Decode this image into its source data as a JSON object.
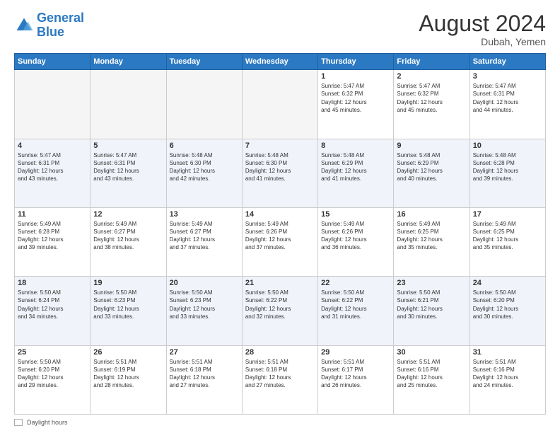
{
  "header": {
    "logo_general": "General",
    "logo_blue": "Blue",
    "month_year": "August 2024",
    "location": "Dubah, Yemen"
  },
  "days_of_week": [
    "Sunday",
    "Monday",
    "Tuesday",
    "Wednesday",
    "Thursday",
    "Friday",
    "Saturday"
  ],
  "footer": {
    "label": "Daylight hours"
  },
  "weeks": [
    {
      "days": [
        {
          "num": "",
          "info": "",
          "empty": true
        },
        {
          "num": "",
          "info": "",
          "empty": true
        },
        {
          "num": "",
          "info": "",
          "empty": true
        },
        {
          "num": "",
          "info": "",
          "empty": true
        },
        {
          "num": "1",
          "info": "Sunrise: 5:47 AM\nSunset: 6:32 PM\nDaylight: 12 hours\nand 45 minutes."
        },
        {
          "num": "2",
          "info": "Sunrise: 5:47 AM\nSunset: 6:32 PM\nDaylight: 12 hours\nand 45 minutes."
        },
        {
          "num": "3",
          "info": "Sunrise: 5:47 AM\nSunset: 6:31 PM\nDaylight: 12 hours\nand 44 minutes."
        }
      ]
    },
    {
      "alt": true,
      "days": [
        {
          "num": "4",
          "info": "Sunrise: 5:47 AM\nSunset: 6:31 PM\nDaylight: 12 hours\nand 43 minutes."
        },
        {
          "num": "5",
          "info": "Sunrise: 5:47 AM\nSunset: 6:31 PM\nDaylight: 12 hours\nand 43 minutes."
        },
        {
          "num": "6",
          "info": "Sunrise: 5:48 AM\nSunset: 6:30 PM\nDaylight: 12 hours\nand 42 minutes."
        },
        {
          "num": "7",
          "info": "Sunrise: 5:48 AM\nSunset: 6:30 PM\nDaylight: 12 hours\nand 41 minutes."
        },
        {
          "num": "8",
          "info": "Sunrise: 5:48 AM\nSunset: 6:29 PM\nDaylight: 12 hours\nand 41 minutes."
        },
        {
          "num": "9",
          "info": "Sunrise: 5:48 AM\nSunset: 6:29 PM\nDaylight: 12 hours\nand 40 minutes."
        },
        {
          "num": "10",
          "info": "Sunrise: 5:48 AM\nSunset: 6:28 PM\nDaylight: 12 hours\nand 39 minutes."
        }
      ]
    },
    {
      "days": [
        {
          "num": "11",
          "info": "Sunrise: 5:49 AM\nSunset: 6:28 PM\nDaylight: 12 hours\nand 39 minutes."
        },
        {
          "num": "12",
          "info": "Sunrise: 5:49 AM\nSunset: 6:27 PM\nDaylight: 12 hours\nand 38 minutes."
        },
        {
          "num": "13",
          "info": "Sunrise: 5:49 AM\nSunset: 6:27 PM\nDaylight: 12 hours\nand 37 minutes."
        },
        {
          "num": "14",
          "info": "Sunrise: 5:49 AM\nSunset: 6:26 PM\nDaylight: 12 hours\nand 37 minutes."
        },
        {
          "num": "15",
          "info": "Sunrise: 5:49 AM\nSunset: 6:26 PM\nDaylight: 12 hours\nand 36 minutes."
        },
        {
          "num": "16",
          "info": "Sunrise: 5:49 AM\nSunset: 6:25 PM\nDaylight: 12 hours\nand 35 minutes."
        },
        {
          "num": "17",
          "info": "Sunrise: 5:49 AM\nSunset: 6:25 PM\nDaylight: 12 hours\nand 35 minutes."
        }
      ]
    },
    {
      "alt": true,
      "days": [
        {
          "num": "18",
          "info": "Sunrise: 5:50 AM\nSunset: 6:24 PM\nDaylight: 12 hours\nand 34 minutes."
        },
        {
          "num": "19",
          "info": "Sunrise: 5:50 AM\nSunset: 6:23 PM\nDaylight: 12 hours\nand 33 minutes."
        },
        {
          "num": "20",
          "info": "Sunrise: 5:50 AM\nSunset: 6:23 PM\nDaylight: 12 hours\nand 33 minutes."
        },
        {
          "num": "21",
          "info": "Sunrise: 5:50 AM\nSunset: 6:22 PM\nDaylight: 12 hours\nand 32 minutes."
        },
        {
          "num": "22",
          "info": "Sunrise: 5:50 AM\nSunset: 6:22 PM\nDaylight: 12 hours\nand 31 minutes."
        },
        {
          "num": "23",
          "info": "Sunrise: 5:50 AM\nSunset: 6:21 PM\nDaylight: 12 hours\nand 30 minutes."
        },
        {
          "num": "24",
          "info": "Sunrise: 5:50 AM\nSunset: 6:20 PM\nDaylight: 12 hours\nand 30 minutes."
        }
      ]
    },
    {
      "days": [
        {
          "num": "25",
          "info": "Sunrise: 5:50 AM\nSunset: 6:20 PM\nDaylight: 12 hours\nand 29 minutes."
        },
        {
          "num": "26",
          "info": "Sunrise: 5:51 AM\nSunset: 6:19 PM\nDaylight: 12 hours\nand 28 minutes."
        },
        {
          "num": "27",
          "info": "Sunrise: 5:51 AM\nSunset: 6:18 PM\nDaylight: 12 hours\nand 27 minutes."
        },
        {
          "num": "28",
          "info": "Sunrise: 5:51 AM\nSunset: 6:18 PM\nDaylight: 12 hours\nand 27 minutes."
        },
        {
          "num": "29",
          "info": "Sunrise: 5:51 AM\nSunset: 6:17 PM\nDaylight: 12 hours\nand 26 minutes."
        },
        {
          "num": "30",
          "info": "Sunrise: 5:51 AM\nSunset: 6:16 PM\nDaylight: 12 hours\nand 25 minutes."
        },
        {
          "num": "31",
          "info": "Sunrise: 5:51 AM\nSunset: 6:16 PM\nDaylight: 12 hours\nand 24 minutes."
        }
      ]
    }
  ]
}
